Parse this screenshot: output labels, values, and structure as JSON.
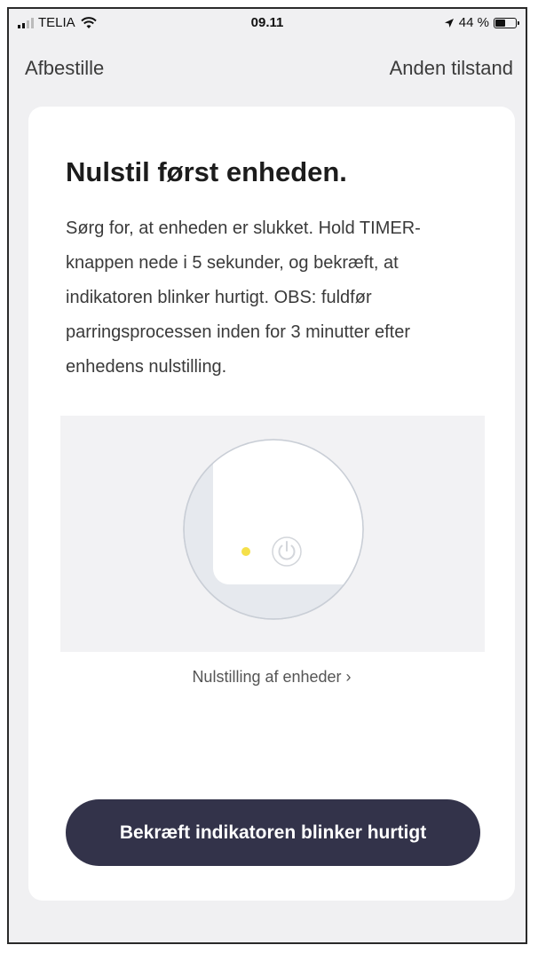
{
  "status_bar": {
    "carrier": "TELIA",
    "time": "09.11",
    "battery": "44 %"
  },
  "nav": {
    "cancel_label": "Afbestille",
    "other_mode_label": "Anden tilstand"
  },
  "card": {
    "title": "Nulstil først enheden.",
    "description": "Sørg for, at enheden er slukket. Hold TIMER-knappen nede i 5 sekunder, og bekræft, at indikatoren blinker hurtigt. OBS: fuldfør parringsprocessen inden for 3 minutter efter enhedens nulstilling.",
    "reset_link": "Nulstilling af enheder ›",
    "confirm_button": "Bekræft indikatoren blinker hurtigt"
  },
  "colors": {
    "button_bg": "#33334a",
    "indicator": "#f5e04a"
  },
  "icons": [
    "signal-icon",
    "wifi-icon",
    "location-arrow-icon",
    "battery-icon",
    "power-icon",
    "indicator-dot"
  ]
}
